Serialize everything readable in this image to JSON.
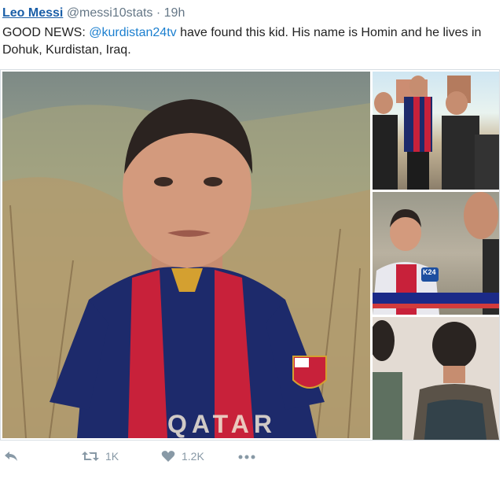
{
  "tweet": {
    "display_name": "Leo Messi",
    "handle": "@messi10stats",
    "separator": "·",
    "time": "19h",
    "text_prefix": "GOOD NEWS: ",
    "mention": "@kurdistan24tv",
    "text_suffix": " have found this kid. His name is Homin and he lives in Dohuk, Kurdistan, Iraq."
  },
  "media": {
    "jersey_sponsor": "QATAR",
    "tv_logo": "K24"
  },
  "actions": {
    "reply_icon": "reply-icon",
    "retweet_icon": "retweet-icon",
    "retweet_count": "1K",
    "like_icon": "heart-icon",
    "like_count": "1.2K",
    "more_icon": "more-icon"
  },
  "colors": {
    "name": "#1b5fa8",
    "mention": "#1b7fcf",
    "muted": "#8899a6",
    "jersey_blue": "#1d2a6b",
    "jersey_red": "#c8213a"
  }
}
